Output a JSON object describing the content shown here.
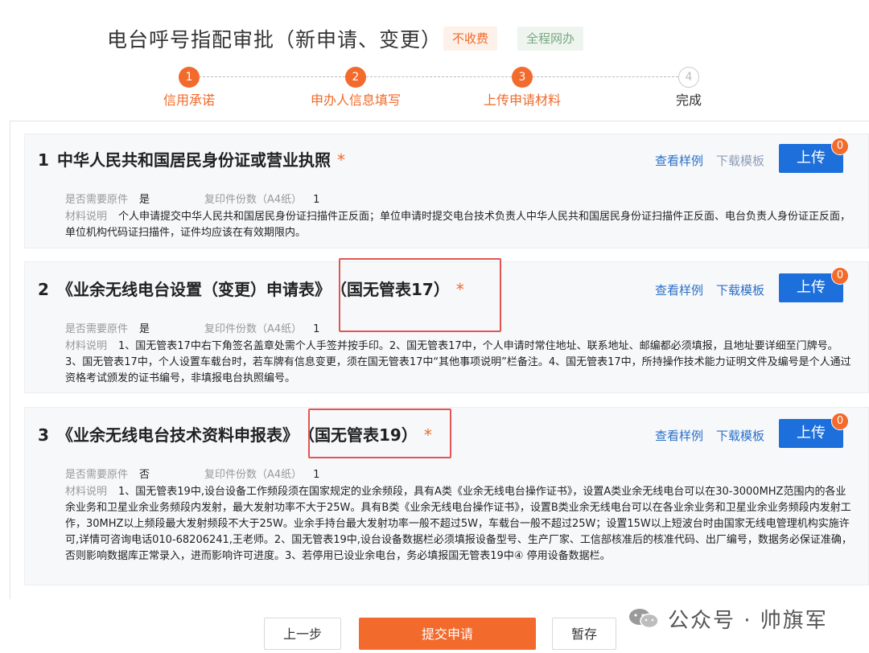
{
  "page": {
    "title": "电台呼号指配审批（新申请、变更）",
    "tags": {
      "fee": "不收费",
      "online": "全程网办"
    }
  },
  "steps": [
    {
      "num": "1",
      "label": "信用承诺",
      "active": true
    },
    {
      "num": "2",
      "label": "申办人信息填写",
      "active": true
    },
    {
      "num": "3",
      "label": "上传申请材料",
      "active": true
    },
    {
      "num": "4",
      "label": "完成",
      "active": false
    }
  ],
  "labels": {
    "original_required": "是否需要原件",
    "copy_count": "复印件份数（A4纸）",
    "description": "材料说明",
    "view_sample": "查看样例",
    "download_template": "下载模板",
    "upload": "上传",
    "required_mark": "*"
  },
  "materials": [
    {
      "num": "1",
      "name": "中华人民共和国居民身份证或营业执照",
      "highlight": "",
      "original_required": "是",
      "copy_count": "1",
      "upload_count": "0",
      "description": "个人申请提交中华人民共和国居民身份证扫描件正反面；单位申请时提交电台技术负责人中华人民共和国居民身份证扫描件正反面、电台负责人身份证正反面，单位机构代码证扫描件，证件均应该在有效期限内。"
    },
    {
      "num": "2",
      "name": "《业余无线电台设置（变更）申请表》",
      "highlight": "（国无管表17）",
      "original_required": "是",
      "copy_count": "1",
      "upload_count": "0",
      "description": "1、国无管表17中右下角签名盖章处需个人手签并按手印。2、国无管表17中，个人申请时常住地址、联系地址、邮编都必须填报，且地址要详细至门牌号。3、国无管表17中，个人设置车载台时，若车牌有信息变更，须在国无管表17中“其他事项说明”栏备注。4、国无管表17中，所持操作技术能力证明文件及编号是个人通过资格考试颁发的证书编号，非填报电台执照编号。"
    },
    {
      "num": "3",
      "name": "《业余无线电台技术资料申报表》",
      "highlight": "（国无管表19）",
      "original_required": "否",
      "copy_count": "1",
      "upload_count": "0",
      "description": "1、国无管表19中,设台设备工作频段须在国家规定的业余频段，具有A类《业余无线电台操作证书》，设置A类业余无线电台可以在30-3000MHZ范围内的各业余业务和卫星业余业务频段内发射，最大发射功率不大于25W。具有B类《业余无线电台操作证书》，设置B类业余无线电台可以在各业余业务和卫星业余业务频段内发射工作，30MHZ以上频段最大发射频段不大于25W。业余手持台最大发射功率一般不超过5W，车载台一般不超过25W；设置15W以上短波台时由国家无线电管理机构实施许可,详情可咨询电话010-68206241,王老师。2、国无管表19中,设台设备数据栏必须填报设备型号、生产厂家、工信部核准后的核准代码、出厂编号，数据务必保证准确，否则影响数据库正常录入，进而影响许可进度。3、若停用已设业余电台，务必填报国无管表19中④ 停用设备数据栏。"
    }
  ],
  "footer": {
    "prev": "上一步",
    "submit": "提交申请",
    "save": "暂存"
  },
  "watermark": {
    "text": "公众号 · 帅旗军",
    "icon": "wechat-icon"
  },
  "colors": {
    "accent": "#f26a2c",
    "primary": "#1d6fdc",
    "link": "#2a6fc9",
    "highlight_border": "#e35555"
  }
}
